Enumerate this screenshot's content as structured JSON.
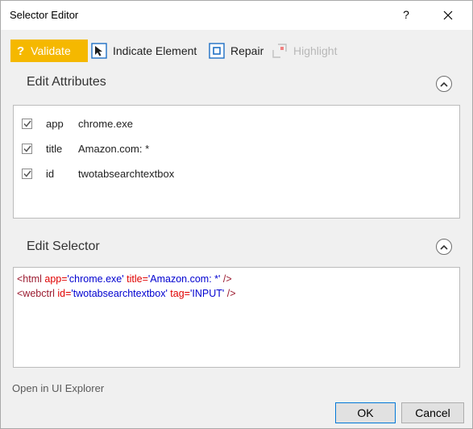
{
  "window": {
    "title": "Selector Editor",
    "help_label": "?"
  },
  "toolbar": {
    "validate_label": "Validate",
    "validate_glyph": "?",
    "indicate_label": "Indicate Element",
    "repair_label": "Repair",
    "highlight_label": "Highlight"
  },
  "attributes": {
    "heading": "Edit Attributes",
    "rows": [
      {
        "name": "app",
        "value": "chrome.exe",
        "checked": true
      },
      {
        "name": "title",
        "value": "Amazon.com: *",
        "checked": true
      },
      {
        "name": "id",
        "value": "twotabsearchtextbox",
        "checked": true
      }
    ]
  },
  "selector": {
    "heading": "Edit Selector",
    "line1": {
      "open": "<html ",
      "a1": "app=",
      "v1": "'chrome.exe'",
      "a2": " title=",
      "v2": "'Amazon.com: *'",
      "close": " />"
    },
    "line2": {
      "open": "<webctrl ",
      "a1": "id=",
      "v1": "'twotabsearchtextbox'",
      "a2": " tag=",
      "v2": "'INPUT'",
      "close": " />"
    }
  },
  "footer": {
    "open_explorer_label": "Open in UI Explorer",
    "ok_label": "OK",
    "cancel_label": "Cancel"
  },
  "colors": {
    "validate_bg": "#f5b800",
    "accent_blue": "#1e6fc5",
    "tag_color": "#9b1b30",
    "attr_color": "#e00000",
    "value_color": "#0000d0"
  },
  "icons": {
    "help": "question-icon",
    "close": "close-icon",
    "indicate": "cursor-target-icon",
    "repair": "repair-target-icon",
    "highlight": "highlight-icon",
    "collapse": "chevron-up-icon",
    "checkbox": "checkmark-icon"
  }
}
